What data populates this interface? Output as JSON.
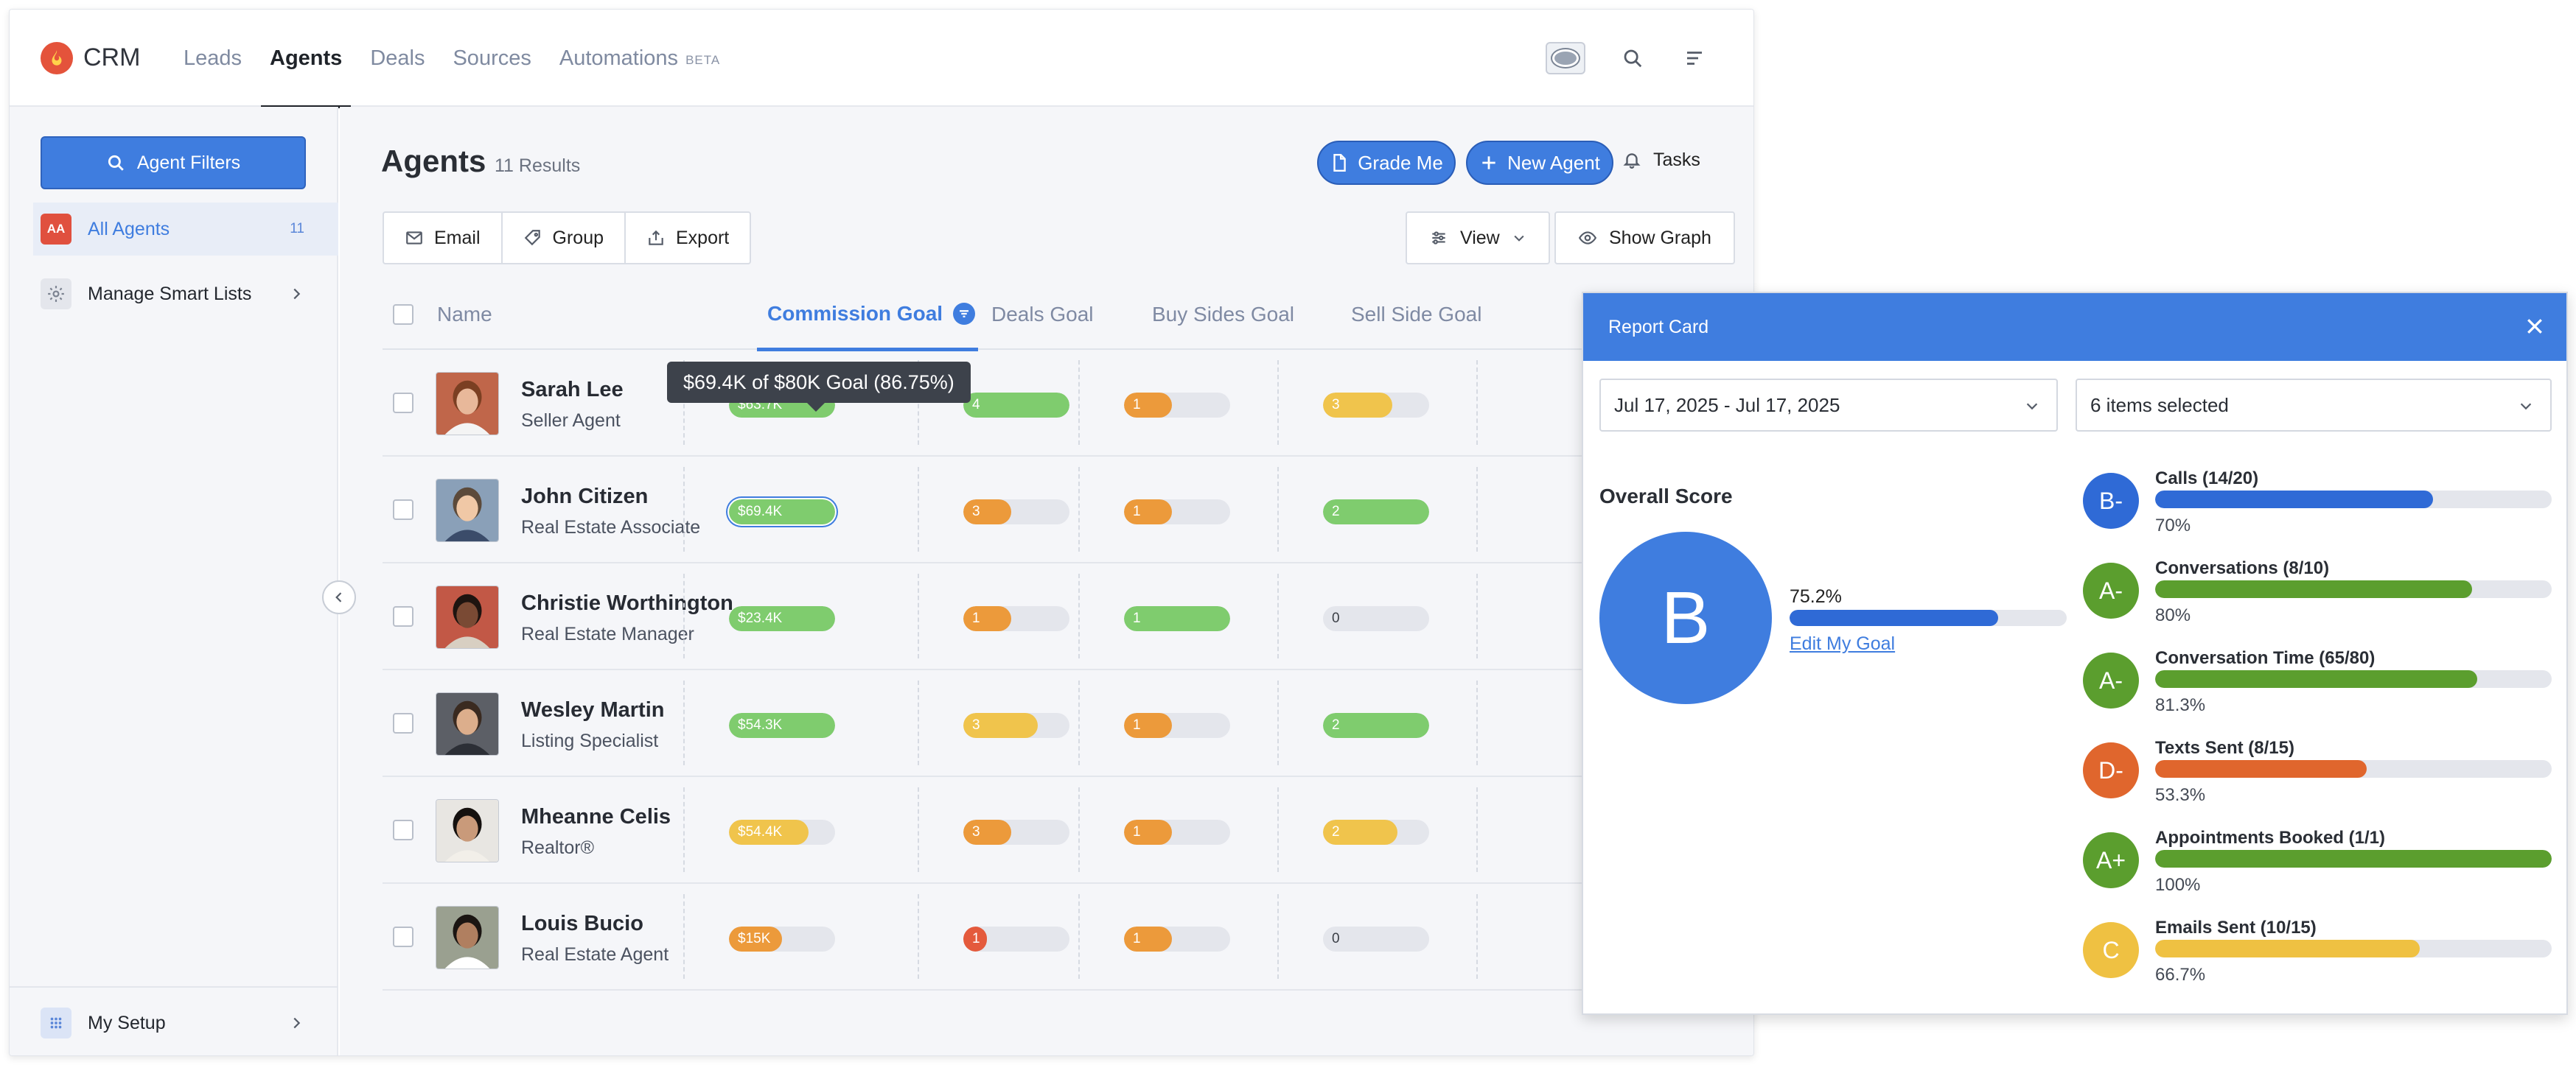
{
  "nav": {
    "brand": "CRM",
    "links": [
      {
        "label": "Leads"
      },
      {
        "label": "Agents",
        "active": true
      },
      {
        "label": "Deals"
      },
      {
        "label": "Sources"
      },
      {
        "label": "Automations",
        "badge": "BETA"
      }
    ],
    "icons": [
      "user-avatar",
      "search-icon",
      "menu-icon"
    ]
  },
  "sidebar": {
    "filter_button": "Agent Filters",
    "all_agents": {
      "badge": "AA",
      "label": "All Agents",
      "count": "11"
    },
    "smart_lists": {
      "label": "Manage Smart Lists"
    },
    "setup": {
      "label": "My Setup"
    }
  },
  "header": {
    "title": "Agents",
    "results": "11 Results",
    "grade_me": "Grade Me",
    "new_agent": "New Agent",
    "tasks": "Tasks"
  },
  "toolbar": {
    "email": "Email",
    "group": "Group",
    "export": "Export",
    "view": "View",
    "show_graph": "Show Graph"
  },
  "table": {
    "columns": {
      "name": "Name",
      "commission": "Commission Goal",
      "deals": "Deals Goal",
      "buy": "Buy Sides Goal",
      "sell": "Sell Side Goal"
    },
    "rows": [
      {
        "name": "Sarah Lee",
        "role": "Seller Agent",
        "commission": {
          "label": "$63.7K",
          "pct": 100,
          "color": "#7fcc6e"
        },
        "deals": {
          "label": "4",
          "pct": 100,
          "color": "#7fcc6e"
        },
        "buy": {
          "label": "1",
          "pct": 45,
          "color": "#ec9a3b"
        },
        "sell": {
          "label": "3",
          "pct": 65,
          "color": "#f0c44c"
        }
      },
      {
        "name": "John Citizen",
        "role": "Real Estate Associate",
        "commission": {
          "label": "$69.4K",
          "pct": 100,
          "color": "#7fcc6e"
        },
        "deals": {
          "label": "3",
          "pct": 45,
          "color": "#ec9a3b"
        },
        "buy": {
          "label": "1",
          "pct": 45,
          "color": "#ec9a3b"
        },
        "sell": {
          "label": "2",
          "pct": 100,
          "color": "#7fcc6e"
        }
      },
      {
        "name": "Christie Worthington",
        "role": "Real Estate Manager",
        "commission": {
          "label": "$23.4K",
          "pct": 100,
          "color": "#7fcc6e"
        },
        "deals": {
          "label": "1",
          "pct": 45,
          "color": "#ec9a3b"
        },
        "buy": {
          "label": "1",
          "pct": 100,
          "color": "#7fcc6e"
        },
        "sell": {
          "label": "0",
          "pct": 0,
          "color": "#e4e6ec"
        }
      },
      {
        "name": "Wesley Martin",
        "role": "Listing Specialist",
        "commission": {
          "label": "$54.3K",
          "pct": 100,
          "color": "#7fcc6e"
        },
        "deals": {
          "label": "3",
          "pct": 70,
          "color": "#f0c44c"
        },
        "buy": {
          "label": "1",
          "pct": 45,
          "color": "#ec9a3b"
        },
        "sell": {
          "label": "2",
          "pct": 100,
          "color": "#7fcc6e"
        }
      },
      {
        "name": "Mheanne Celis",
        "role": "Realtor®",
        "commission": {
          "label": "$54.4K",
          "pct": 75,
          "color": "#f0c44c"
        },
        "deals": {
          "label": "3",
          "pct": 45,
          "color": "#ec9a3b"
        },
        "buy": {
          "label": "1",
          "pct": 45,
          "color": "#ec9a3b"
        },
        "sell": {
          "label": "2",
          "pct": 70,
          "color": "#f0c44c"
        }
      },
      {
        "name": "Louis Bucio",
        "role": "Real Estate Agent",
        "commission": {
          "label": "$15K",
          "pct": 50,
          "color": "#ec9a3b"
        },
        "deals": {
          "label": "1",
          "pct": 22,
          "color": "#e45a3c"
        },
        "buy": {
          "label": "1",
          "pct": 45,
          "color": "#ec9a3b"
        },
        "sell": {
          "label": "0",
          "pct": 0,
          "color": "#e4e6ec"
        }
      }
    ],
    "tooltip": "$69.4K of $80K Goal (86.75%)"
  },
  "report": {
    "title": "Report Card",
    "date_range": "Jul 17, 2025 - Jul 17, 2025",
    "items": "6 items selected",
    "overall_label": "Overall Score",
    "overall_grade": "B",
    "overall_pct": "75.2%",
    "overall_value": 75.2,
    "edit_goal": "Edit My Goal",
    "metrics": [
      {
        "grade": "B-",
        "label": "Calls (14/20)",
        "pct": "70%",
        "value": 70,
        "color": "#2f6ad6"
      },
      {
        "grade": "A-",
        "label": "Conversations (8/10)",
        "pct": "80%",
        "value": 80,
        "color": "#5b9e2e"
      },
      {
        "grade": "A-",
        "label": "Conversation Time (65/80)",
        "pct": "81.3%",
        "value": 81.3,
        "color": "#5b9e2e"
      },
      {
        "grade": "D-",
        "label": "Texts Sent (8/15)",
        "pct": "53.3%",
        "value": 53.3,
        "color": "#e0662d"
      },
      {
        "grade": "A+",
        "label": "Appointments Booked (1/1)",
        "pct": "100%",
        "value": 100,
        "color": "#5b9e2e"
      },
      {
        "grade": "C",
        "label": "Emails Sent (10/15)",
        "pct": "66.7%",
        "value": 66.7,
        "color": "#efc142"
      }
    ]
  }
}
